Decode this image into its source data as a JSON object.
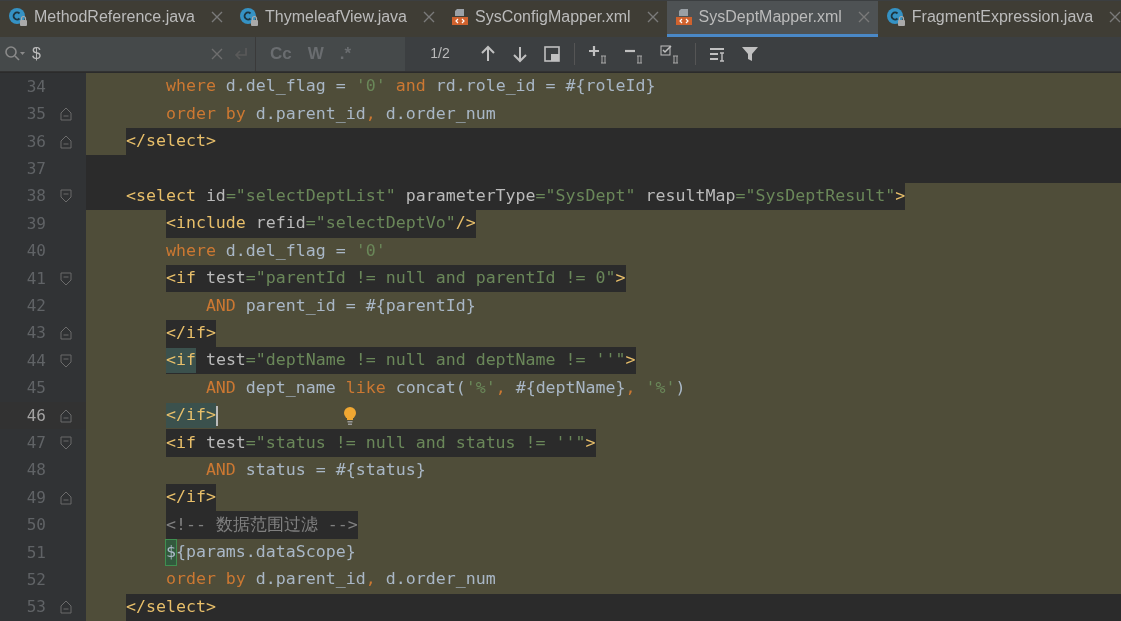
{
  "tabs": [
    {
      "label": "MethodReference.java",
      "kind": "class",
      "selected": false
    },
    {
      "label": "ThymeleafView.java",
      "kind": "class",
      "selected": false
    },
    {
      "label": "SysConfigMapper.xml",
      "kind": "xml",
      "selected": false
    },
    {
      "label": "SysDeptMapper.xml",
      "kind": "xml",
      "selected": true
    },
    {
      "label": "FragmentExpression.java",
      "kind": "class",
      "selected": false
    }
  ],
  "find_bar": {
    "value": "$",
    "toggles": [
      {
        "label": "Cc",
        "selected": false
      },
      {
        "label": "W",
        "selected": false
      },
      {
        "label": ".*",
        "selected": false
      }
    ],
    "match_count": "1/2"
  },
  "lines": [
    {
      "children": [
        {
          "number": "34",
          "current": false,
          "fold_start": false,
          "fold_end": false,
          "parts": [
            {
              "highlighted": true,
              "tokens": [
                {
                  "kind": "kw",
                  "text": "where"
                },
                {
                  "kind": "text",
                  "text": " d.del_flag = "
                },
                {
                  "kind": "str",
                  "text": "'0'"
                },
                {
                  "kind": "kw",
                  "text": " and"
                },
                {
                  "kind": "text",
                  "text": " rd.role_id = #{roleId}"
                }
              ]
            }
          ]
        },
        {
          "number": "35",
          "current": false,
          "fold_start": false,
          "fold_end": true,
          "parts": [
            {
              "highlighted": true,
              "tokens": [
                {
                  "kind": "kw",
                  "text": "order by"
                },
                {
                  "kind": "text",
                  "text": " d.parent_id"
                },
                {
                  "kind": "kw",
                  "text": ","
                },
                {
                  "kind": "text",
                  "text": " d.order_num"
                }
              ]
            }
          ]
        }
      ]
    },
    {
      "number": "36",
      "current": false,
      "fold_start": false,
      "fold_end": true,
      "parts": [
        {
          "highlighted": true
        },
        {
          "highlighted": false,
          "tokens": [
            {
              "kind": "tag",
              "text": "</select>"
            }
          ]
        }
      ]
    },
    {
      "number": "37",
      "current": false,
      "fold_start": false,
      "fold_end": false
    },
    {
      "number": "38",
      "current": false,
      "fold_start": true,
      "fold_end": false,
      "parts": [
        {
          "highlighted": false,
          "tokens": [
            {
              "kind": "tag",
              "text": "<select"
            },
            {
              "kind": "attr",
              "text": " id"
            },
            {
              "kind": "str",
              "text": "=\"selectDeptList\""
            },
            {
              "kind": "attr",
              "text": " parameterType"
            },
            {
              "kind": "str",
              "text": "=\"SysDept\""
            },
            {
              "kind": "attr",
              "text": " resultMap"
            },
            {
              "kind": "str",
              "text": "=\"SysDeptResult\""
            },
            {
              "kind": "tag",
              "text": ">"
            }
          ]
        },
        {
          "highlighted": true
        }
      ],
      "children": [
        {
          "number": "39",
          "current": false,
          "fold_start": false,
          "fold_end": false,
          "parts": [
            {
              "highlighted": true
            },
            {
              "highlighted": false,
              "tokens": [
                {
                  "kind": "tag",
                  "text": "<include"
                },
                {
                  "kind": "attr",
                  "text": " refid"
                },
                {
                  "kind": "str",
                  "text": "=\"selectDeptVo\""
                },
                {
                  "kind": "tag",
                  "text": "/>"
                }
              ]
            },
            {
              "highlighted": true
            }
          ]
        },
        {
          "number": "40",
          "current": false,
          "fold_start": false,
          "fold_end": false,
          "parts": [
            {
              "highlighted": true,
              "tokens": [
                {
                  "kind": "kw",
                  "text": "where"
                },
                {
                  "kind": "text",
                  "text": " d.del_flag = "
                },
                {
                  "kind": "str",
                  "text": "'0'"
                }
              ]
            }
          ]
        },
        {
          "number": "41",
          "current": false,
          "fold_start": true,
          "fold_end": false,
          "parts": [
            {
              "highlighted": true
            },
            {
              "highlighted": false,
              "tokens": [
                {
                  "kind": "tag",
                  "text": "<if"
                },
                {
                  "kind": "attr",
                  "text": " test"
                },
                {
                  "kind": "str",
                  "text": "=\"parentId != null and parentId != 0\""
                },
                {
                  "kind": "tag",
                  "text": ">"
                }
              ]
            },
            {
              "highlighted": true
            }
          ],
          "children": [
            {
              "number": "42",
              "current": false,
              "fold_start": false,
              "fold_end": false,
              "parts": [
                {
                  "highlighted": true,
                  "tokens": [
                    {
                      "kind": "kw",
                      "text": "AND"
                    },
                    {
                      "kind": "text",
                      "text": " parent_id = #{parentId}"
                    }
                  ]
                }
              ]
            }
          ]
        },
        {
          "number": "43",
          "current": false,
          "fold_start": false,
          "fold_end": true,
          "parts": [
            {
              "highlighted": true
            },
            {
              "highlighted": false,
              "tokens": [
                {
                  "kind": "tag",
                  "text": "</if>"
                }
              ]
            },
            {
              "highlighted": true
            }
          ]
        },
        {
          "number": "44",
          "current": false,
          "fold_start": true,
          "fold_end": false,
          "parts": [
            {
              "highlighted": true
            },
            {
              "highlighted": false,
              "tokens": [
                {
                  "kind": "match",
                  "text": "<if"
                },
                {
                  "kind": "attr",
                  "text": " test"
                },
                {
                  "kind": "str",
                  "text": "=\"deptName != null and deptName != ''\""
                },
                {
                  "kind": "tag",
                  "text": ">"
                }
              ]
            },
            {
              "highlighted": true
            }
          ],
          "children": [
            {
              "number": "45",
              "current": false,
              "fold_start": false,
              "fold_end": false,
              "parts": [
                {
                  "highlighted": true,
                  "tokens": [
                    {
                      "kind": "kw",
                      "text": "AND"
                    },
                    {
                      "kind": "text",
                      "text": " dept_name "
                    },
                    {
                      "kind": "kw",
                      "text": "like"
                    },
                    {
                      "kind": "text",
                      "text": " concat("
                    },
                    {
                      "kind": "str",
                      "text": "'%'"
                    },
                    {
                      "kind": "kw",
                      "text": ","
                    },
                    {
                      "kind": "text",
                      "text": " #{deptName}"
                    },
                    {
                      "kind": "kw",
                      "text": ","
                    },
                    {
                      "kind": "str",
                      "text": " '%'"
                    },
                    {
                      "kind": "text",
                      "text": ")"
                    }
                  ]
                }
              ]
            }
          ]
        },
        {
          "number": "46",
          "current": true,
          "fold_start": false,
          "fold_end": true,
          "parts": [
            {
              "highlighted": true,
              "tokens": [
                {
                  "kind": "match",
                  "text": "</if>"
                }
              ]
            },
            {
              "highlighted": true,
              "tokens": [
                {
                  "kind": "caret"
                },
                {
                  "kind": "bulb"
                }
              ]
            }
          ]
        },
        {
          "number": "47",
          "current": false,
          "fold_start": true,
          "fold_end": false,
          "parts": [
            {
              "highlighted": true
            },
            {
              "highlighted": false,
              "tokens": [
                {
                  "kind": "tag",
                  "text": "<if"
                },
                {
                  "kind": "attr",
                  "text": " test"
                },
                {
                  "kind": "str",
                  "text": "=\"status != null and status != ''\""
                },
                {
                  "kind": "tag",
                  "text": ">"
                }
              ]
            },
            {
              "highlighted": true
            }
          ],
          "children": [
            {
              "number": "48",
              "current": false,
              "fold_start": false,
              "fold_end": false,
              "parts": [
                {
                  "highlighted": true,
                  "tokens": [
                    {
                      "kind": "kw",
                      "text": "AND"
                    },
                    {
                      "kind": "text",
                      "text": " status = #{status}"
                    }
                  ]
                }
              ]
            }
          ]
        },
        {
          "number": "49",
          "current": false,
          "fold_start": false,
          "fold_end": true,
          "parts": [
            {
              "highlighted": true
            },
            {
              "highlighted": false,
              "tokens": [
                {
                  "kind": "tag",
                  "text": "</if>"
                }
              ]
            },
            {
              "highlighted": true
            }
          ]
        },
        {
          "number": "50",
          "current": false,
          "fold_start": false,
          "fold_end": false,
          "parts": [
            {
              "highlighted": true
            },
            {
              "highlighted": false,
              "tokens": [
                {
                  "kind": "comment",
                  "text": "<!-- 数据范围过滤 -->"
                }
              ]
            },
            {
              "highlighted": true
            }
          ]
        },
        {
          "number": "51",
          "current": false,
          "fold_start": false,
          "fold_end": false,
          "parts": [
            {
              "highlighted": true,
              "tokens": [
                {
                  "kind": "find",
                  "text": "$"
                },
                {
                  "kind": "text",
                  "text": "{params.dataScope}"
                }
              ]
            }
          ]
        },
        {
          "number": "52",
          "current": false,
          "fold_start": false,
          "fold_end": false,
          "parts": [
            {
              "highlighted": true,
              "tokens": [
                {
                  "kind": "kw",
                  "text": "order by"
                },
                {
                  "kind": "text",
                  "text": " d.parent_id"
                },
                {
                  "kind": "kw",
                  "text": ","
                },
                {
                  "kind": "text",
                  "text": " d.order_num"
                }
              ]
            }
          ]
        }
      ]
    },
    {
      "number": "53",
      "current": false,
      "fold_start": false,
      "fold_end": true,
      "parts": [
        {
          "highlighted": true
        },
        {
          "highlighted": false,
          "tokens": [
            {
              "kind": "tag",
              "text": "</select>"
            }
          ]
        }
      ]
    }
  ]
}
